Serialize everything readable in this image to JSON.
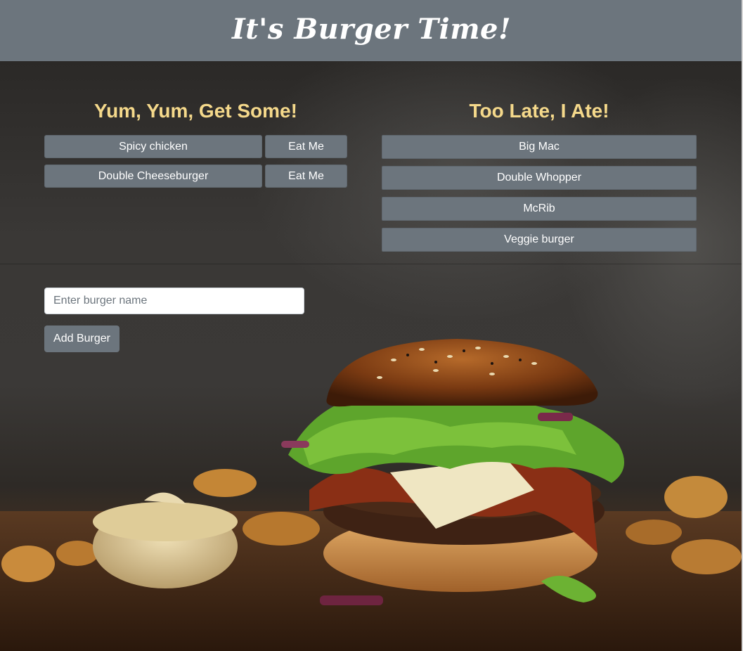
{
  "header": {
    "title": "It's Burger Time!"
  },
  "columns": {
    "left_title": "Yum, Yum, Get Some!",
    "right_title": "Too Late, I Ate!"
  },
  "to_eat": [
    {
      "name": "Spicy chicken",
      "action": "Eat Me"
    },
    {
      "name": "Double Cheeseburger",
      "action": "Eat Me"
    }
  ],
  "eaten": [
    {
      "name": "Big Mac"
    },
    {
      "name": "Double Whopper"
    },
    {
      "name": "McRib"
    },
    {
      "name": "Veggie burger"
    }
  ],
  "form": {
    "placeholder": "Enter burger name",
    "value": "",
    "submit_label": "Add Burger"
  },
  "colors": {
    "header_bg": "#6c757d",
    "button_bg": "#6c757d",
    "title_gold": "#f5d98b"
  }
}
